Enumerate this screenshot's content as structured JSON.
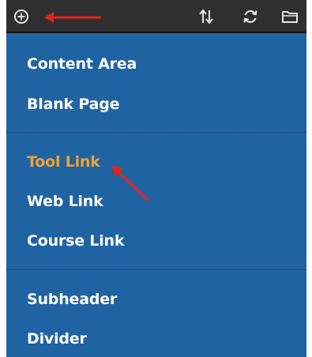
{
  "toolbar": {
    "icons": [
      "add-circle-icon",
      "sort-icon",
      "refresh-icon",
      "folder-icon"
    ],
    "background": "#2f2f2f"
  },
  "menu": {
    "background": "#2063a3",
    "active_color": "#f0a332",
    "groups": [
      {
        "items": [
          {
            "label": "Content Area"
          },
          {
            "label": "Blank Page"
          }
        ]
      },
      {
        "items": [
          {
            "label": "Tool Link",
            "active": true
          },
          {
            "label": "Web Link"
          },
          {
            "label": "Course Link"
          }
        ]
      },
      {
        "items": [
          {
            "label": "Subheader"
          },
          {
            "label": "Divider"
          }
        ]
      }
    ]
  },
  "annotations": {
    "arrow_color": "#e2231a"
  }
}
